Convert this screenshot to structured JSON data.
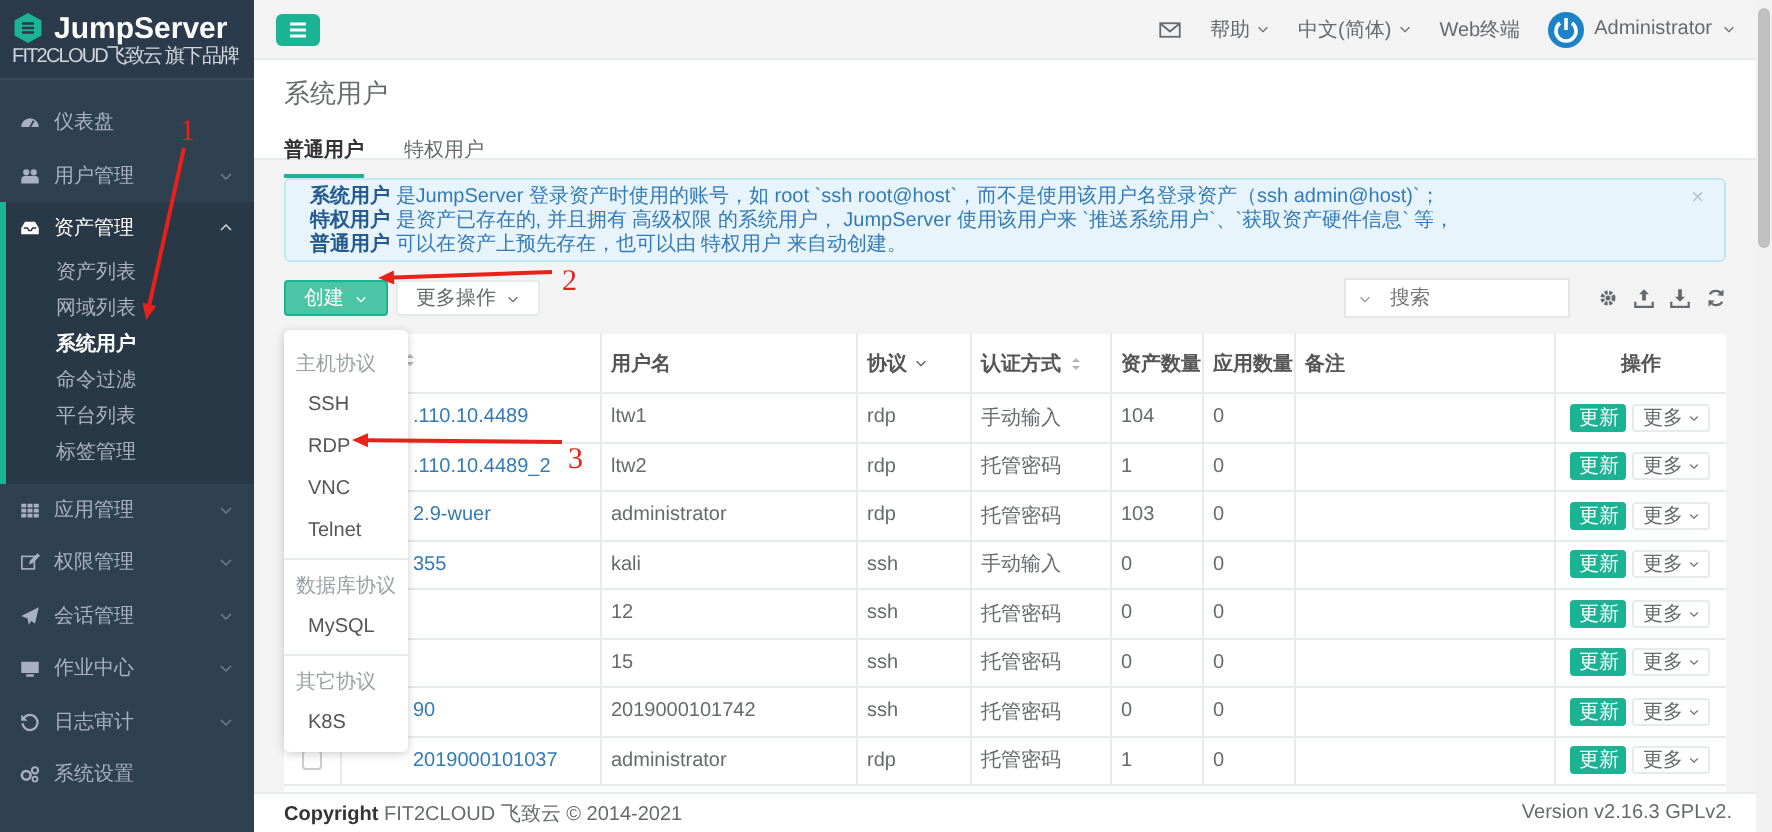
{
  "sidebar": {
    "logo": {
      "title": "JumpServer",
      "subtitle": "FIT2CLOUD飞致云 旗下品牌"
    },
    "items": [
      {
        "label": "仪表盘",
        "selected": false
      },
      {
        "label": "用户管理",
        "expanded": false,
        "selected": false
      },
      {
        "label": "资产管理",
        "expanded": true,
        "selected": true,
        "children": [
          {
            "label": "资产列表",
            "selected": false
          },
          {
            "label": "网域列表",
            "selected": false
          },
          {
            "label": "系统用户",
            "selected": true
          },
          {
            "label": "命令过滤",
            "selected": false
          },
          {
            "label": "平台列表",
            "selected": false
          },
          {
            "label": "标签管理",
            "selected": false
          }
        ]
      },
      {
        "label": "应用管理",
        "expanded": false,
        "selected": false
      },
      {
        "label": "权限管理",
        "expanded": false,
        "selected": false
      },
      {
        "label": "会话管理",
        "expanded": false,
        "selected": false
      },
      {
        "label": "作业中心",
        "expanded": false,
        "selected": false
      },
      {
        "label": "日志审计",
        "expanded": false,
        "selected": false
      },
      {
        "label": "系统设置",
        "selected": false
      }
    ]
  },
  "topbar": {
    "help": "帮助",
    "language": "中文(简体)",
    "web_terminal": "Web终端",
    "user": "Administrator"
  },
  "page": {
    "title": "系统用户",
    "tabs": [
      {
        "label": "普通用户",
        "selected": true
      },
      {
        "label": "特权用户",
        "selected": false
      }
    ]
  },
  "alert": {
    "close": "×",
    "lines": [
      "**系统用户** 是JumpServer 登录资产时使用的账号，如 root `ssh root@host`，而不是使用该用户名登录资产（ssh admin@host)`；",
      "**特权用户** 是资产已存在的, 并且拥有 高级权限 的系统用户， JumpServer 使用该用户来 `推送系统用户`、`获取资产硬件信息` 等，",
      "**普通用户** 可以在资产上预先存在，也可以由 特权用户 来自动创建。"
    ]
  },
  "toolbar": {
    "create": "创建",
    "more_actions": "更多操作",
    "search": {
      "placeholder": "搜索"
    }
  },
  "create_menu": {
    "groups": [
      {
        "title": "主机协议",
        "items": [
          "SSH",
          "RDP",
          "VNC",
          "Telnet"
        ]
      },
      {
        "title": "数据库协议",
        "items": [
          "MySQL"
        ]
      },
      {
        "title": "其它协议",
        "items": [
          "K8S"
        ]
      }
    ]
  },
  "table": {
    "columns": [
      {
        "sortable": true
      },
      {
        "label": "用户名"
      },
      {
        "label": "协议",
        "filterable": true
      },
      {
        "label": "认证方式",
        "sortable": true
      },
      {
        "label": "资产数量"
      },
      {
        "label": "应用数量"
      },
      {
        "label": "备注"
      },
      {
        "label": "操作"
      }
    ],
    "rows": [
      {
        "name": ".110.10.4489",
        "username": "ltw1",
        "protocol": "rdp",
        "auth": "手动输入",
        "assets": "104",
        "apps": "0",
        "update": "更新",
        "more": "更多"
      },
      {
        "name": ".110.10.4489_2",
        "username": "ltw2",
        "protocol": "rdp",
        "auth": "托管密码",
        "assets": "1",
        "apps": "0",
        "update": "更新",
        "more": "更多"
      },
      {
        "name": "2.9-wuer",
        "username": "administrator",
        "protocol": "rdp",
        "auth": "托管密码",
        "assets": "103",
        "apps": "0",
        "update": "更新",
        "more": "更多"
      },
      {
        "name": "355",
        "username": "kali",
        "protocol": "ssh",
        "auth": "手动输入",
        "assets": "0",
        "apps": "0",
        "update": "更新",
        "more": "更多"
      },
      {
        "username": "12",
        "protocol": "ssh",
        "auth": "托管密码",
        "assets": "0",
        "apps": "0",
        "update": "更新",
        "more": "更多"
      },
      {
        "username": "15",
        "protocol": "ssh",
        "auth": "托管密码",
        "assets": "0",
        "apps": "0",
        "update": "更新",
        "more": "更多"
      },
      {
        "name": "90",
        "username": "2019000101742",
        "protocol": "ssh",
        "auth": "托管密码",
        "assets": "0",
        "apps": "0",
        "update": "更新",
        "more": "更多"
      },
      {
        "checked": false,
        "name": "2019000101037",
        "username": "administrator",
        "protocol": "rdp",
        "auth": "托管密码",
        "assets": "1",
        "apps": "0",
        "update": "更新",
        "more": "更多"
      }
    ]
  },
  "footer": {
    "copyright": "**Copyright** FIT2CLOUD 飞致云 © 2014-2021",
    "version": "Version v2.16.3 GPLv2."
  },
  "annotations": [
    {
      "label": "1"
    },
    {
      "label": "2"
    },
    {
      "label": "3"
    }
  ]
}
